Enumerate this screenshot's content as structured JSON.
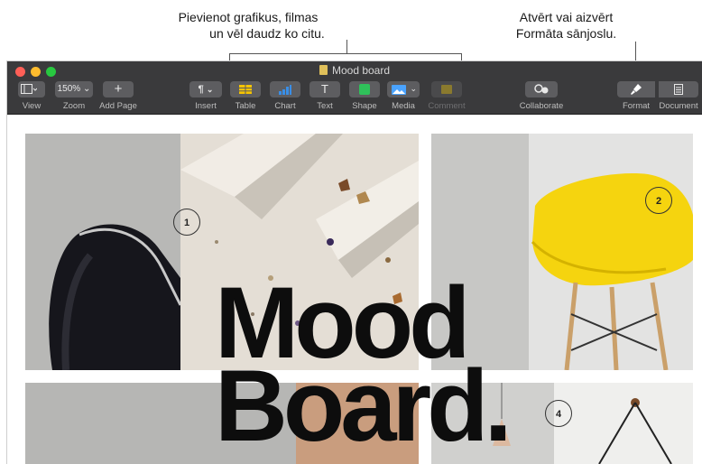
{
  "callouts": {
    "left_line1": "Pievienot grafikus, filmas",
    "left_line2": "un vēl daudz ko citu.",
    "right_line1": "Atvērt vai aizvērt",
    "right_line2": "Formāta sānjoslu."
  },
  "window": {
    "title": "Mood board"
  },
  "toolbar": {
    "view": {
      "label": "View"
    },
    "zoom": {
      "label": "Zoom",
      "value": "150%"
    },
    "add_page": {
      "label": "Add Page"
    },
    "insert": {
      "label": "Insert"
    },
    "table": {
      "label": "Table"
    },
    "chart": {
      "label": "Chart"
    },
    "text": {
      "label": "Text"
    },
    "shape": {
      "label": "Shape"
    },
    "media": {
      "label": "Media"
    },
    "comment": {
      "label": "Comment"
    },
    "collaborate": {
      "label": "Collaborate"
    },
    "format": {
      "label": "Format"
    },
    "document": {
      "label": "Document"
    }
  },
  "document": {
    "headline_line1": "Mood",
    "headline_line2": "Board.",
    "markers": [
      "1",
      "2",
      "4"
    ]
  },
  "colors": {
    "toolbar_bg": "#3a3a3c",
    "accent_yellow": "#f5d40f",
    "traffic_red": "#fe5f57",
    "traffic_yellow": "#febc2e",
    "traffic_green": "#28c840"
  }
}
